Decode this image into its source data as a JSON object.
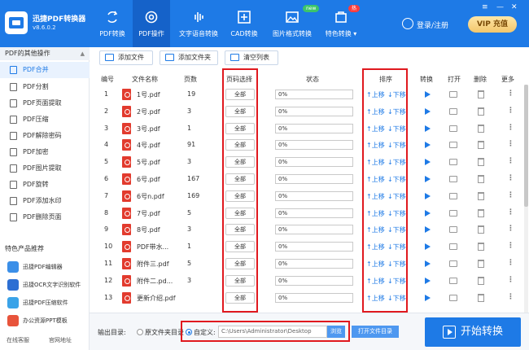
{
  "app": {
    "name": "迅捷PDF转换器",
    "version": "v8.6.0.2"
  },
  "nav": [
    {
      "label": "PDF转换",
      "icon": "pdf-convert-icon",
      "active": false
    },
    {
      "label": "PDF操作",
      "icon": "pdf-operate-icon",
      "active": true
    },
    {
      "label": "文字语音转换",
      "icon": "voice-icon",
      "active": false
    },
    {
      "label": "CAD转换",
      "icon": "cad-icon",
      "active": false
    },
    {
      "label": "图片格式转换",
      "icon": "image-icon",
      "active": false,
      "badge": "new"
    },
    {
      "label": "特色转换",
      "icon": "special-icon",
      "active": false,
      "badge": "热"
    }
  ],
  "user": {
    "login_label": "登录/注册",
    "vip_label": "充值",
    "vip_prefix": "VIP"
  },
  "sidebar": {
    "section_title": "PDF的其他操作",
    "items": [
      {
        "label": "PDF合并",
        "active": true
      },
      {
        "label": "PDF分割",
        "active": false
      },
      {
        "label": "PDF页面提取",
        "active": false
      },
      {
        "label": "PDF压缩",
        "active": false
      },
      {
        "label": "PDF解除密码",
        "active": false
      },
      {
        "label": "PDF加密",
        "active": false
      },
      {
        "label": "PDF图片提取",
        "active": false
      },
      {
        "label": "PDF旋转",
        "active": false
      },
      {
        "label": "PDF添加水印",
        "active": false
      },
      {
        "label": "PDF删除页面",
        "active": false
      }
    ],
    "products_title": "特色产品推荐",
    "products": [
      {
        "label": "迅捷PDF编辑器",
        "color": "#3b8fe8"
      },
      {
        "label": "迅捷OCR文字识别软件",
        "color": "#2d6fd3"
      },
      {
        "label": "迅捷PDF压缩软件",
        "color": "#3aa3e8"
      },
      {
        "label": "办公资源PPT模板",
        "color": "#e8543b"
      }
    ],
    "footer": {
      "service": "在线客服",
      "website": "官网地址"
    }
  },
  "toolbar": {
    "add_file": "添加文件",
    "add_folder": "添加文件夹",
    "clear_list": "清空列表"
  },
  "table": {
    "headers": {
      "index": "编号",
      "name": "文件名称",
      "pages": "页数",
      "page_select": "页码选择",
      "status": "状态",
      "order": "排序",
      "convert": "转换",
      "open": "打开",
      "delete": "删除",
      "more": "更多"
    },
    "rows": [
      {
        "index": "1",
        "name": "1号.pdf",
        "pages": "19",
        "page_select": "全部",
        "status": "0%",
        "up": "↑上移",
        "down": "↓下移"
      },
      {
        "index": "2",
        "name": "2号.pdf",
        "pages": "3",
        "page_select": "全部",
        "status": "0%",
        "up": "↑上移",
        "down": "↓下移"
      },
      {
        "index": "3",
        "name": "3号.pdf",
        "pages": "1",
        "page_select": "全部",
        "status": "0%",
        "up": "↑上移",
        "down": "↓下移"
      },
      {
        "index": "4",
        "name": "4号.pdf",
        "pages": "91",
        "page_select": "全部",
        "status": "0%",
        "up": "↑上移",
        "down": "↓下移"
      },
      {
        "index": "5",
        "name": "5号.pdf",
        "pages": "3",
        "page_select": "全部",
        "status": "0%",
        "up": "↑上移",
        "down": "↓下移"
      },
      {
        "index": "6",
        "name": "6号.pdf",
        "pages": "167",
        "page_select": "全部",
        "status": "0%",
        "up": "↑上移",
        "down": "↓下移"
      },
      {
        "index": "7",
        "name": "6号n.pdf",
        "pages": "169",
        "page_select": "全部",
        "status": "0%",
        "up": "↑上移",
        "down": "↓下移"
      },
      {
        "index": "8",
        "name": "7号.pdf",
        "pages": "5",
        "page_select": "全部",
        "status": "0%",
        "up": "↑上移",
        "down": "↓下移"
      },
      {
        "index": "9",
        "name": "8号.pdf",
        "pages": "3",
        "page_select": "全部",
        "status": "0%",
        "up": "↑上移",
        "down": "↓下移"
      },
      {
        "index": "10",
        "name": "PDF带水...",
        "pages": "1",
        "page_select": "全部",
        "status": "0%",
        "up": "↑上移",
        "down": "↓下移"
      },
      {
        "index": "11",
        "name": "附件三.pdf",
        "pages": "5",
        "page_select": "全部",
        "status": "0%",
        "up": "↑上移",
        "down": "↓下移"
      },
      {
        "index": "12",
        "name": "附件二.pd...",
        "pages": "3",
        "page_select": "全部",
        "status": "0%",
        "up": "↑上移",
        "down": "↓下移"
      },
      {
        "index": "13",
        "name": "更新介绍.pdf",
        "pages": "",
        "page_select": "全部",
        "status": "0%",
        "up": "↑上移",
        "down": "↓下移"
      }
    ]
  },
  "output": {
    "label": "输出目录:",
    "option_source": "原文件夹目录",
    "option_custom": "自定义:",
    "path": "C:\\Users\\Administrator\\Desktop",
    "browse": "浏览",
    "open_dir": "打开文件目录",
    "start": "开始转换"
  },
  "colors": {
    "accent": "#1e7ae6",
    "highlight_box": "#e0191f",
    "pdf_icon": "#e23b2e"
  }
}
